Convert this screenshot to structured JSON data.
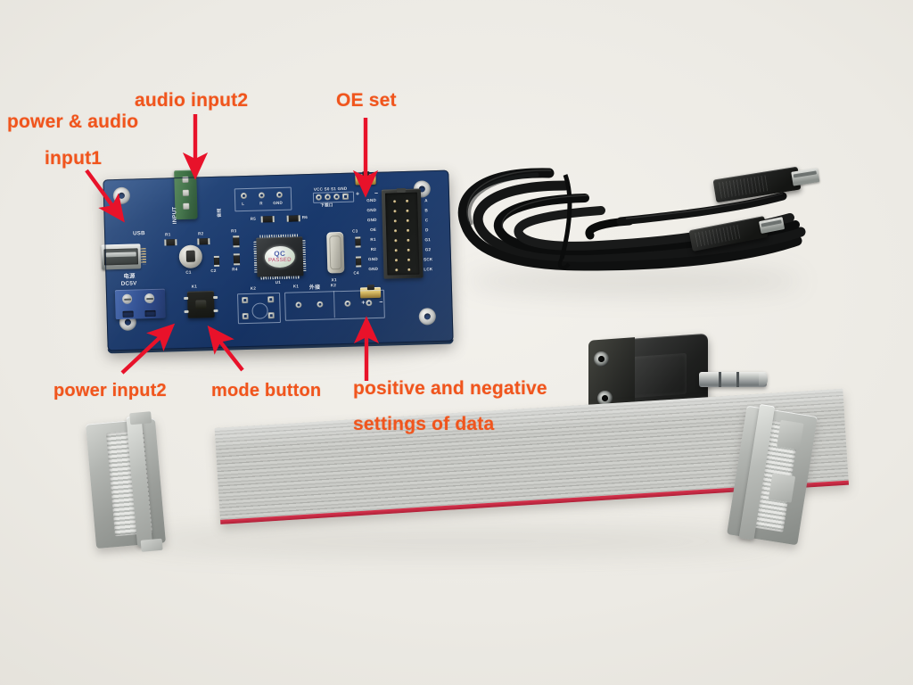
{
  "scene": {
    "title": "LED matrix controller kit photo with annotations",
    "background_color": "#eeece7",
    "annotation_color": "#f0551d",
    "arrow_color": "#e8122a"
  },
  "annotations": [
    {
      "id": "power-audio-input1",
      "line1": "power & audio",
      "line2": "input1",
      "target": "usb-mini-port"
    },
    {
      "id": "audio-input2",
      "line1": "audio input2",
      "line2": "",
      "target": "green-terminal-block"
    },
    {
      "id": "oe-set",
      "line1": "OE set",
      "line2": "",
      "target": "oe-jumper"
    },
    {
      "id": "power-input2",
      "line1": "power input2",
      "line2": "",
      "target": "blue-screw-terminal"
    },
    {
      "id": "mode-button",
      "line1": "mode button",
      "line2": "",
      "target": "tactile-switch"
    },
    {
      "id": "positive-negative",
      "line1": "positive and negative",
      "line2": "settings of data",
      "target": "polarity-jumper"
    }
  ],
  "board": {
    "name": "LED matrix control board",
    "color": "#18376a",
    "silkscreen": {
      "usb": "USB",
      "input": "INPUT",
      "power_cn": "电源",
      "power_dc": "DC5V",
      "audio_cn": "音频",
      "ext_cn": "外接",
      "jack_l": "L",
      "jack_r": "R",
      "jack_gnd": "GND",
      "vcc_row": "VCC S0 S1 GND",
      "down_cn": "下载口",
      "r1": "R1",
      "r2": "R2",
      "r3": "R3",
      "r4": "R4",
      "r5": "R5",
      "r6": "R6",
      "c1": "C1",
      "c2": "C2",
      "c3": "C3",
      "c4": "C4",
      "u1": "U1",
      "x1": "X1",
      "k1_label": "K1",
      "k2_label": "K2",
      "k2_pad": "K2",
      "plus": "+",
      "minus": "−",
      "hub_pins_left": [
        "GND",
        "GND",
        "GND",
        "OE",
        "R1",
        "R2",
        "GND",
        "GND"
      ],
      "hub_pins_right": [
        "A",
        "B",
        "C",
        "D",
        "G1",
        "G2",
        "SCK",
        "LCK"
      ]
    },
    "chip_sticker": {
      "line1": "QC",
      "line2": "PASSED"
    }
  },
  "parts": [
    {
      "id": "usb-cable",
      "label": "black USB cable, coiled"
    },
    {
      "id": "audio-splitter",
      "label": "3.5mm audio splitter, 1 male to 2 female"
    },
    {
      "id": "ribbon-cable",
      "label": "16-pin gray IDC ribbon cable with red stripe"
    }
  ]
}
